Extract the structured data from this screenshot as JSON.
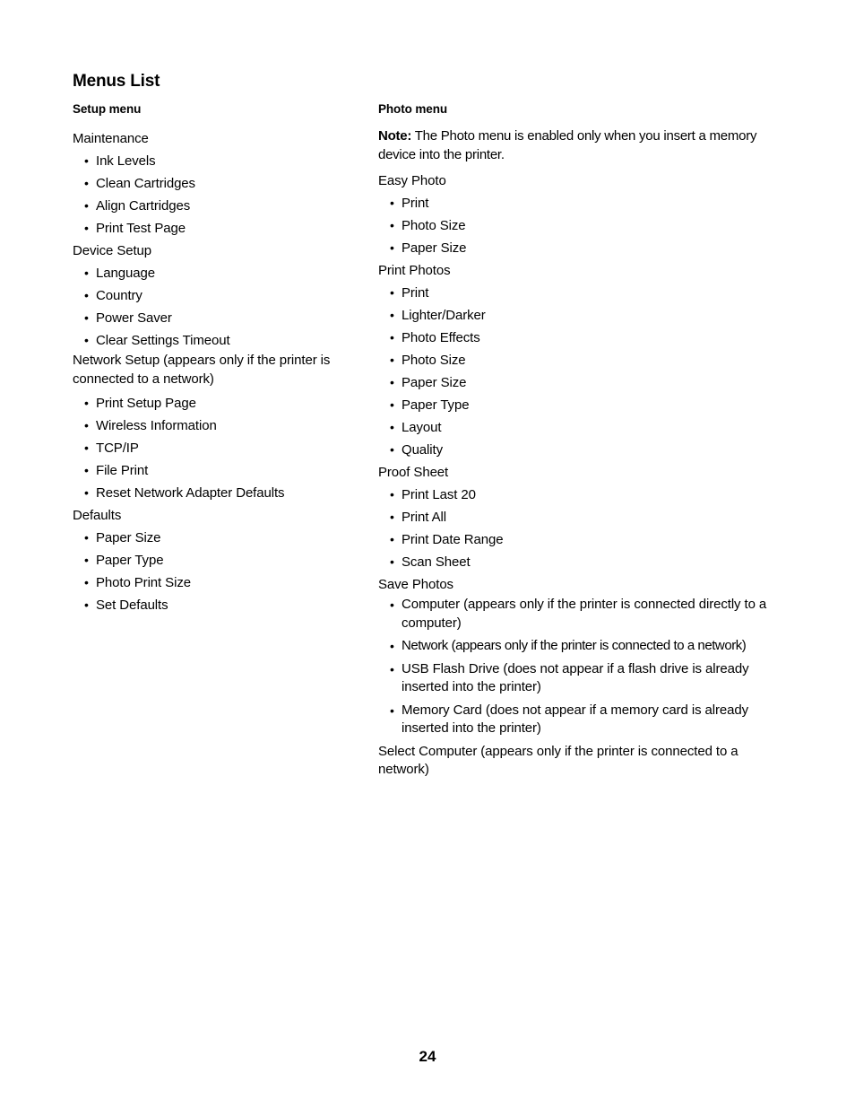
{
  "document": {
    "title": "Menus List",
    "page_number": "24"
  },
  "setup_column": {
    "heading": "Setup menu",
    "groups": [
      {
        "label": "Maintenance",
        "items": [
          "Ink Levels",
          "Clean Cartridges",
          "Align Cartridges",
          "Print Test Page"
        ]
      },
      {
        "label": "Device Setup",
        "items": [
          "Language",
          "Country",
          "Power Saver",
          "Clear Settings Timeout"
        ]
      },
      {
        "label": "Network Setup (appears only if the printer is connected to a network)",
        "items": [
          "Print Setup Page",
          "Wireless Information",
          "TCP/IP",
          "File Print",
          "Reset Network Adapter Defaults"
        ]
      },
      {
        "label": "Defaults",
        "items": [
          "Paper Size",
          "Paper Type",
          "Photo Print Size",
          "Set Defaults"
        ]
      }
    ]
  },
  "photo_column": {
    "heading": "Photo menu",
    "note_label": "Note:",
    "note_text": " The Photo menu is enabled only when you insert a memory device into the printer.",
    "groups": [
      {
        "label": "Easy Photo",
        "items": [
          "Print",
          "Photo Size",
          "Paper Size"
        ]
      },
      {
        "label": "Print Photos",
        "items": [
          "Print",
          "Lighter/Darker",
          "Photo Effects",
          "Photo Size",
          "Paper Size",
          "Paper Type",
          "Layout",
          "Quality"
        ]
      },
      {
        "label": "Proof Sheet",
        "items": [
          "Print Last 20",
          "Print All",
          "Print Date Range",
          "Scan Sheet"
        ]
      },
      {
        "label": "Save Photos",
        "items": [
          "Computer (appears only if the printer is connected directly to a computer)",
          "Network (appears only if the printer is connected to a network)",
          "USB Flash Drive (does not appear if a flash drive is already inserted into the printer)",
          "Memory Card (does not appear if a memory card is already inserted into the printer)"
        ]
      }
    ],
    "trailing_text": "Select Computer (appears only if the printer is connected to a network)"
  }
}
